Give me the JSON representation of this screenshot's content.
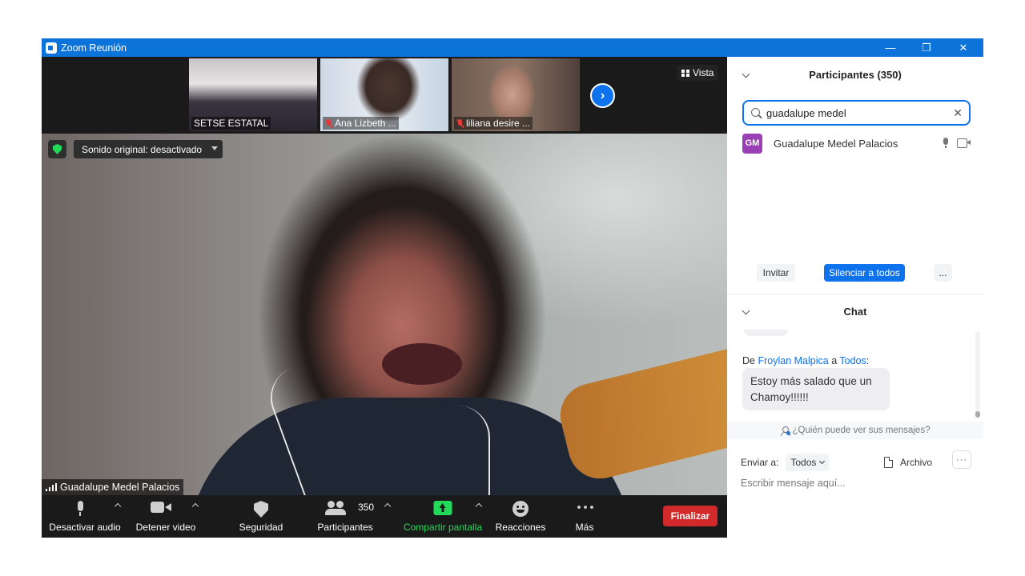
{
  "window": {
    "title": "Zoom Reunión",
    "controls": {
      "minimize": "—",
      "restore": "❐",
      "close": "✕"
    }
  },
  "colors": {
    "accent": "#0e72ed",
    "titlebar": "#0b73d9",
    "end": "#d22a2a",
    "share": "#23d959",
    "avatar": "#9b3fb5"
  },
  "strip": {
    "thumbs": [
      {
        "name": "SETSE ESTATAL",
        "muted": false
      },
      {
        "name": "Ana Lizbeth ...",
        "muted": true
      },
      {
        "name": "liliana desire ...",
        "muted": true
      }
    ],
    "next_icon": "chevron-right-icon",
    "next_glyph": "›",
    "view_label": "Vista"
  },
  "video": {
    "sound_label": "Sonido original: desactivado",
    "speaker_name": "Guadalupe Medel Palacios"
  },
  "toolbar": {
    "mute": "Desactivar audio",
    "video": "Detener video",
    "security": "Seguridad",
    "participants": "Participantes",
    "participants_count": "350",
    "share": "Compartir pantalla",
    "reactions": "Reacciones",
    "more": "Más",
    "end": "Finalizar"
  },
  "participants_panel": {
    "title": "Participantes (350)",
    "search_value": "guadalupe medel",
    "clear_glyph": "✕",
    "results": [
      {
        "initials": "GM",
        "name": "Guadalupe Medel Palacios"
      }
    ],
    "invite": "Invitar",
    "mute_all": "Silenciar a todos",
    "more": "..."
  },
  "chat": {
    "title": "Chat",
    "message": {
      "from_prefix": "De",
      "sender": "Froylan Malpica",
      "to_word": "a",
      "recipient": "Todos",
      "colon": ":",
      "text": "Estoy más salado que un Chamoy!!!!!!"
    },
    "who_sees": "¿Quién puede ver sus mensajes?",
    "send_to_label": "Enviar a:",
    "send_to_value": "Todos",
    "file": "Archivo",
    "more": "···",
    "input_placeholder": "Escribir mensaje aquí..."
  }
}
